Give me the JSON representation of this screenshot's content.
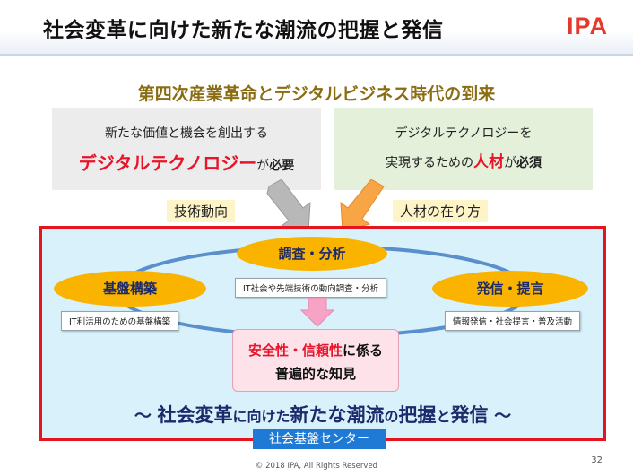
{
  "title": "社会変革に向けた新たな潮流の把握と発信",
  "logo_text": "IPA",
  "subtitle": "第四次産業革命とデジタルビジネス時代の到来",
  "left_box": {
    "line1": "新たな価値と機会を創出する",
    "emph": "デジタルテクノロジー",
    "connector": "が",
    "tail": "必要"
  },
  "right_box": {
    "line1": "デジタルテクノロジーを",
    "line2_pre": "実現するための",
    "emph": "人材",
    "connector": "が",
    "tail": "必須"
  },
  "tags": {
    "left": "技術動向",
    "right": "人材の在り方"
  },
  "cycle": {
    "top": {
      "label": "調査・分析",
      "note": "IT社会や先端技術の動向調査・分析"
    },
    "left": {
      "label": "基盤構築",
      "note": "IT利活用のための基盤構築"
    },
    "right": {
      "label": "発信・提言",
      "note": "情報発信・社会提言・普及活動"
    }
  },
  "center": {
    "part1": "安全性・信頼性",
    "part2": "に係る",
    "line2": "普遍的な知見"
  },
  "bottom": {
    "tilde_left": "～",
    "p1": "社会変革",
    "p2": "に",
    "p3": "向けた",
    "p4": "新たな",
    "p5": "潮流",
    "p6": "の",
    "p7": "把握",
    "p8": "と",
    "p9": "発信",
    "tilde_right": "～"
  },
  "center_label": "社会基盤センター",
  "copyright": "© 2018 IPA, All Rights Reserved",
  "page_number": "32",
  "colors": {
    "frame": "#e4151f",
    "accent_red": "#e8142a",
    "pill": "#fab400",
    "navy": "#1b2a6b",
    "label_blue": "#1f7ad6"
  }
}
